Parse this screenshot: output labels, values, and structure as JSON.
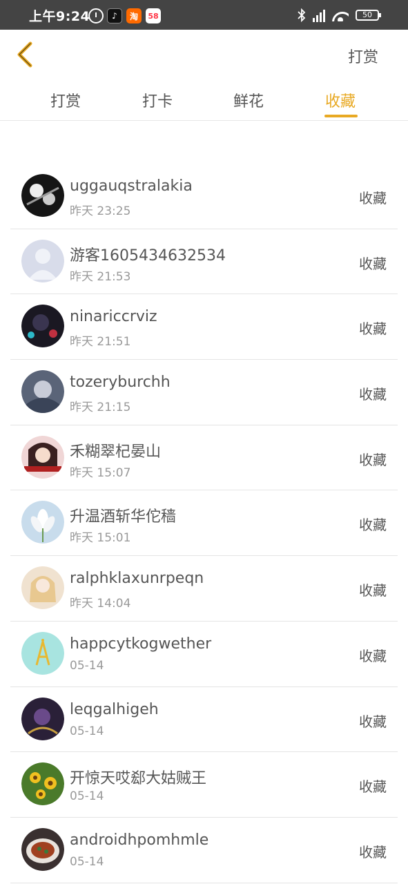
{
  "status_bar": {
    "time": "上午9:24",
    "battery": "50",
    "app_icons": [
      "alarm-icon",
      "tiktok-icon",
      "taobao-icon",
      "58-icon"
    ],
    "app_58_label": "58"
  },
  "header": {
    "action_label": "打赏"
  },
  "tabs": [
    {
      "label": "打赏",
      "active": false
    },
    {
      "label": "打卡",
      "active": false
    },
    {
      "label": "鲜花",
      "active": false
    },
    {
      "label": "收藏",
      "active": true
    }
  ],
  "colors": {
    "accent": "#e8a923",
    "text": "#555555",
    "subtext": "#999999",
    "status_bar": "#444444"
  },
  "items": [
    {
      "name": "uggauqstralakia",
      "time": "昨天 23:25",
      "action": "收藏"
    },
    {
      "name": "游客1605434632534",
      "time": "昨天 21:53",
      "action": "收藏"
    },
    {
      "name": "ninariccrviz",
      "time": "昨天 21:51",
      "action": "收藏"
    },
    {
      "name": "tozeryburchh",
      "time": "昨天 21:15",
      "action": "收藏"
    },
    {
      "name": "禾糊翠杞晏山",
      "time": "昨天 15:07",
      "action": "收藏"
    },
    {
      "name": "升温酒斩华佗穑",
      "time": "昨天 15:01",
      "action": "收藏"
    },
    {
      "name": "ralphklaxunrpeqn",
      "time": "昨天 14:04",
      "action": "收藏"
    },
    {
      "name": "happcytkogwether",
      "time": "05-14",
      "action": "收藏"
    },
    {
      "name": "leqgalhigeh",
      "time": "05-14",
      "action": "收藏"
    },
    {
      "name": "开惊天哎郄大姑贼王",
      "time": "05-14",
      "action": "收藏"
    },
    {
      "name": "androidhpomhmle",
      "time": "05-14",
      "action": "收藏"
    }
  ]
}
